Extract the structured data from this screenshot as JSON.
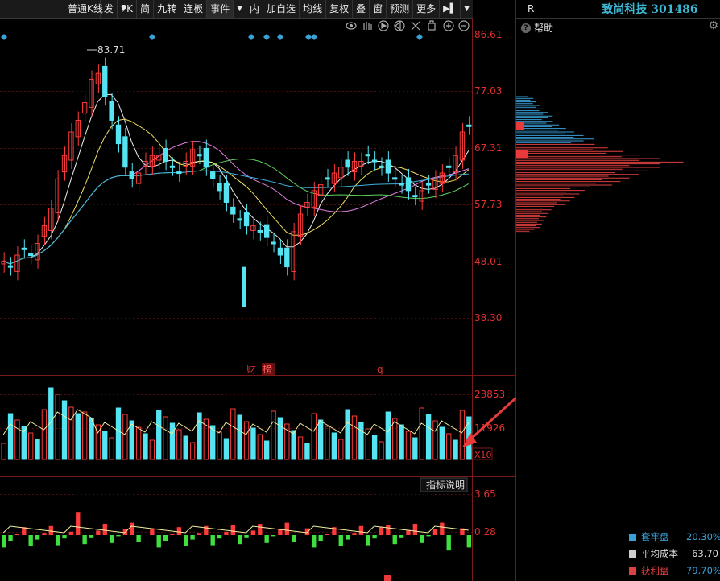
{
  "toolbar": {
    "kline_type": "普通K线",
    "items": [
      "发",
      "PK",
      "简",
      "九转",
      "连板",
      "事件",
      "内",
      "加自选",
      "均线",
      "复权",
      "叠",
      "窗",
      "预测",
      "更多"
    ]
  },
  "stock": {
    "name": "致尚科技 301486",
    "tag": "R"
  },
  "help_label": "帮助",
  "price_axis": [
    "86.61",
    "77.03",
    "67.31",
    "57.73",
    "48.01",
    "38.30"
  ],
  "max_price_label": "83.71",
  "markers": {
    "cai": "财",
    "bang": "榜",
    "q": "q"
  },
  "volume_axis": {
    "top": "23853",
    "mid": "11926",
    "unit": "X10"
  },
  "indicator_axis": {
    "top": "3.65",
    "mid": "0.28"
  },
  "indicator_btn": "指标说明",
  "legend": [
    {
      "label": "套牢盘",
      "value": "20.30%",
      "color": "#3aa0d8",
      "value_color": "#3aa0d8"
    },
    {
      "label": "平均成本",
      "value": "63.70",
      "color": "#d0d0d0",
      "value_color": "#dddddd"
    },
    {
      "label": "获利盘",
      "value": "79.70%",
      "color": "#e04040",
      "value_color": "#3aa0d8"
    }
  ],
  "colors": {
    "up": "#ff3b3b",
    "down": "#54e4f2",
    "grid": "#5a1010",
    "text": "#e03030"
  }
}
